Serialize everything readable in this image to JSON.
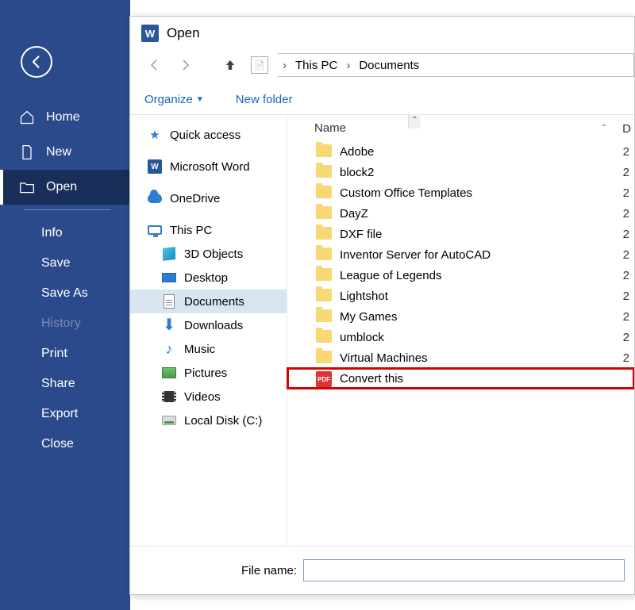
{
  "word_sidebar": {
    "items": [
      {
        "id": "home",
        "label": "Home"
      },
      {
        "id": "new",
        "label": "New"
      },
      {
        "id": "open",
        "label": "Open",
        "selected": true
      }
    ],
    "sub": [
      {
        "id": "info",
        "label": "Info"
      },
      {
        "id": "save",
        "label": "Save"
      },
      {
        "id": "saveas",
        "label": "Save As"
      },
      {
        "id": "history",
        "label": "History",
        "disabled": true
      },
      {
        "id": "print",
        "label": "Print"
      },
      {
        "id": "share",
        "label": "Share"
      },
      {
        "id": "export",
        "label": "Export"
      },
      {
        "id": "close",
        "label": "Close"
      }
    ]
  },
  "dialog": {
    "title": "Open",
    "breadcrumb": [
      "This PC",
      "Documents"
    ],
    "toolbar": {
      "organize": "Organize",
      "newfolder": "New folder"
    },
    "tree": [
      {
        "id": "quick",
        "label": "Quick access",
        "icon": "quick"
      },
      {
        "id": "msword",
        "label": "Microsoft Word",
        "icon": "word"
      },
      {
        "id": "onedrive",
        "label": "OneDrive",
        "icon": "cloud"
      },
      {
        "id": "thispc",
        "label": "This PC",
        "icon": "monitor"
      },
      {
        "id": "3d",
        "label": "3D Objects",
        "icon": "cube",
        "level": 1
      },
      {
        "id": "desktop",
        "label": "Desktop",
        "icon": "desktop",
        "level": 1
      },
      {
        "id": "documents",
        "label": "Documents",
        "icon": "doc",
        "level": 1,
        "selected": true
      },
      {
        "id": "downloads",
        "label": "Downloads",
        "icon": "dl",
        "level": 1
      },
      {
        "id": "music",
        "label": "Music",
        "icon": "music",
        "level": 1
      },
      {
        "id": "pictures",
        "label": "Pictures",
        "icon": "pict",
        "level": 1
      },
      {
        "id": "videos",
        "label": "Videos",
        "icon": "vid",
        "level": 1
      },
      {
        "id": "cdisk",
        "label": "Local Disk (C:)",
        "icon": "disk",
        "level": 1
      }
    ],
    "list_header": {
      "col1": "Name",
      "col_right": "D"
    },
    "rows": [
      {
        "name": "Adobe",
        "type": "folder",
        "d": "2"
      },
      {
        "name": "block2",
        "type": "folder",
        "d": "2"
      },
      {
        "name": "Custom Office Templates",
        "type": "folder",
        "d": "2"
      },
      {
        "name": "DayZ",
        "type": "folder",
        "d": "2"
      },
      {
        "name": "DXF file",
        "type": "folder",
        "d": "2"
      },
      {
        "name": "Inventor Server for AutoCAD",
        "type": "folder",
        "d": "2"
      },
      {
        "name": "League of Legends",
        "type": "folder",
        "d": "2"
      },
      {
        "name": "Lightshot",
        "type": "folder",
        "d": "2"
      },
      {
        "name": "My Games",
        "type": "folder",
        "d": "2"
      },
      {
        "name": "umblock",
        "type": "folder",
        "d": "2"
      },
      {
        "name": "Virtual Machines",
        "type": "folder",
        "d": "2"
      },
      {
        "name": "Convert this",
        "type": "pdf",
        "highlight": true,
        "d": ""
      }
    ],
    "footer": {
      "label": "File name:",
      "value": ""
    }
  }
}
